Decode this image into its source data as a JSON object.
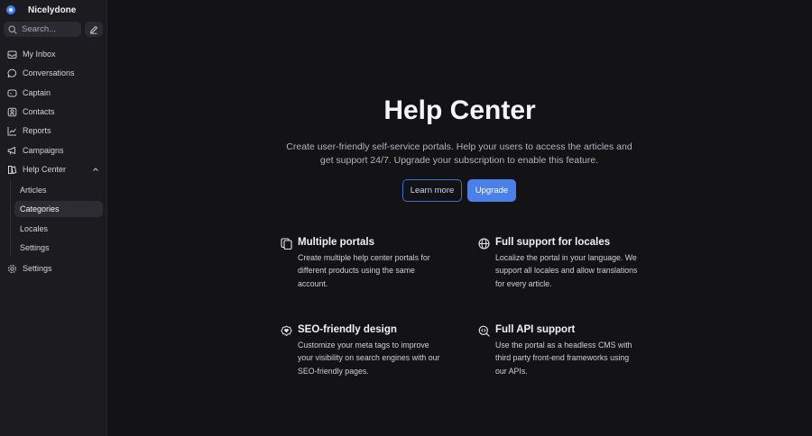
{
  "sidebar": {
    "brand": "Nicelydone",
    "search_placeholder": "Search...",
    "nav": [
      {
        "label": "My Inbox",
        "icon": "inbox-icon"
      },
      {
        "label": "Conversations",
        "icon": "chat-bubble-icon"
      },
      {
        "label": "Captain",
        "icon": "captain-icon"
      },
      {
        "label": "Contacts",
        "icon": "contacts-icon"
      },
      {
        "label": "Reports",
        "icon": "chart-line-icon"
      },
      {
        "label": "Campaigns",
        "icon": "megaphone-icon"
      },
      {
        "label": "Help Center",
        "icon": "book-icon",
        "expanded": true
      },
      {
        "label": "Settings",
        "icon": "gear-icon"
      }
    ],
    "help_center_children": [
      {
        "label": "Articles",
        "active": false
      },
      {
        "label": "Categories",
        "active": true
      },
      {
        "label": "Locales",
        "active": false
      },
      {
        "label": "Settings",
        "active": false
      }
    ]
  },
  "main": {
    "title": "Help Center",
    "description": "Create user-friendly self-service portals. Help your users to access the articles and get support 24/7. Upgrade your subscription to enable this feature.",
    "learn_more": "Learn more",
    "upgrade": "Upgrade",
    "features": [
      {
        "title": "Multiple portals",
        "desc": "Create multiple help center portals for different products using the same account.",
        "icon": "copy-pages-icon"
      },
      {
        "title": "Full support for locales",
        "desc": "Localize the portal in your language. We support all locales and allow translations for every article.",
        "icon": "globe-icon"
      },
      {
        "title": "SEO-friendly design",
        "desc": "Customize your meta tags to improve your visibility on search engines with our SEO-friendly pages.",
        "icon": "heart-badge-icon"
      },
      {
        "title": "Full API support",
        "desc": "Use the portal as a headless CMS with third party front-end frameworks using our APIs.",
        "icon": "search-code-icon"
      }
    ]
  },
  "colors": {
    "background": "#131316",
    "sidebar": "#1c1c20",
    "accent": "#4a80e8"
  }
}
